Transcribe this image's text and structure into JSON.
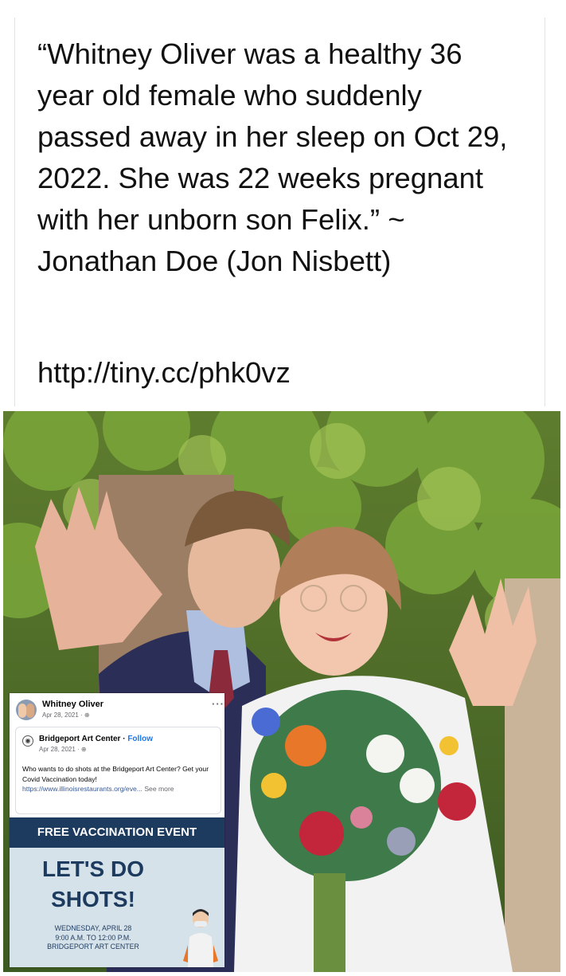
{
  "quote": {
    "text": "“Whitney Oliver was a healthy 36 year old female who suddenly passed away in her sleep on Oct 29, 2022. She was 22 weeks pregnant with her unborn son Felix.” ~ Jonathan Doe (Jon Nisbett)",
    "link": "http://tiny.cc/phk0vz"
  },
  "embedded_post": {
    "author": "Whitney Oliver",
    "date": "Apr 28, 2021 · ",
    "more": "···",
    "shared": {
      "page_name": "Bridgeport Art Center",
      "separator": " · ",
      "follow": "Follow",
      "date": "Apr 28, 2021 · ",
      "body": "Who wants to do shots at the Bridgeport Art Center? Get your Covid Vaccination today! ",
      "link": "https://www.illinoisrestaurants.org/eve...",
      "see_more": " See more"
    },
    "banner": "FREE VACCINATION EVENT",
    "headline_line1": "LET'S DO",
    "headline_line2": "SHOTS!",
    "details_line1": "WEDNESDAY, APRIL 28",
    "details_line2": "9:00 A.M. TO 12:00 P.M.",
    "details_line3": "BRIDGEPORT ART CENTER"
  },
  "icons": [
    "globe-icon",
    "more-icon",
    "page-icon"
  ],
  "colors": {
    "banner_bg": "#1d3a5f",
    "poster_bg": "#d6e2ea",
    "follow": "#1877f2"
  }
}
